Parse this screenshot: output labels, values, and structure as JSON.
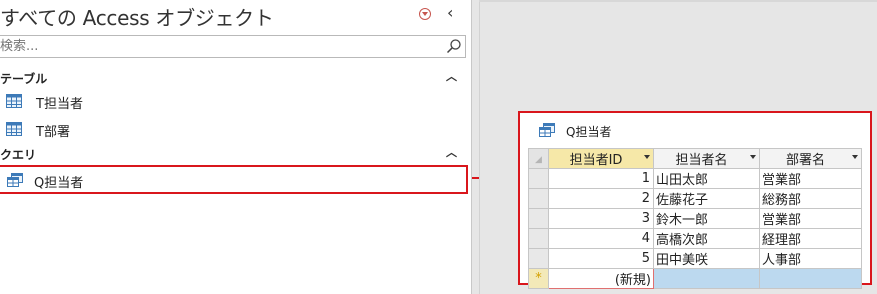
{
  "nav": {
    "title": "すべての Access オブジェクト",
    "search_placeholder": "検索...",
    "groups": [
      {
        "label": "テーブル",
        "items": [
          {
            "label": "T担当者"
          },
          {
            "label": "T部署"
          }
        ]
      },
      {
        "label": "クエリ",
        "items": [
          {
            "label": "Q担当者",
            "highlighted": true
          }
        ]
      }
    ]
  },
  "query_window": {
    "title": "Q担当者",
    "columns": [
      "担当者ID",
      "担当者名",
      "部署名"
    ],
    "rows": [
      [
        "1",
        "山田太郎",
        "営業部"
      ],
      [
        "2",
        "佐藤花子",
        "総務部"
      ],
      [
        "3",
        "鈴木一郎",
        "営業部"
      ],
      [
        "4",
        "高橋次郎",
        "経理部"
      ],
      [
        "5",
        "田中美咲",
        "人事部"
      ]
    ],
    "new_row_marker": "*",
    "new_row_label": "(新規)"
  },
  "colors": {
    "highlight_border": "#d9161c",
    "selected_header": "#f6e8a8",
    "new_row": "#bcd9ef"
  }
}
